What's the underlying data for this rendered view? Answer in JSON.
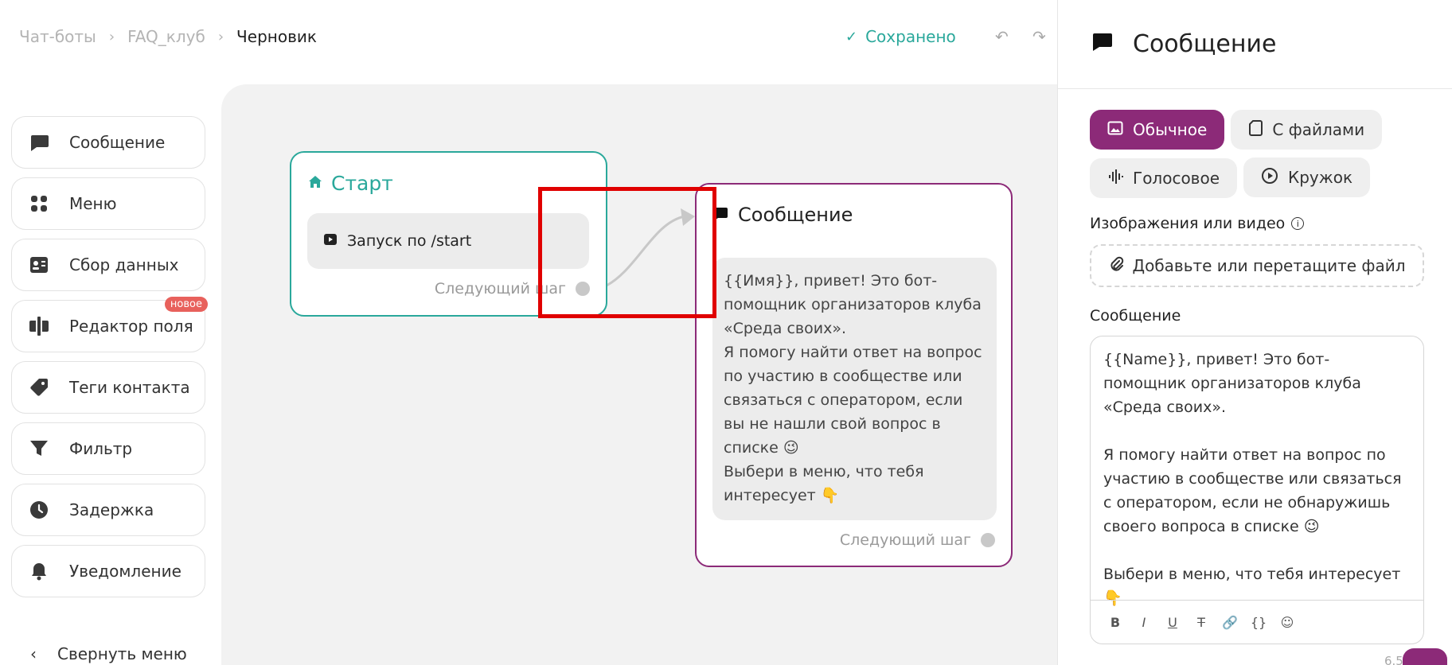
{
  "breadcrumb": {
    "items": [
      "Чат-боты",
      "FAQ_клуб"
    ],
    "current": "Черновик",
    "separator": "›"
  },
  "status": {
    "saved_label": "Сохранено"
  },
  "toolbar": {
    "undo_icon": "undo-icon",
    "redo_icon": "redo-icon"
  },
  "sidebar": {
    "items": [
      {
        "label": "Сообщение",
        "icon": "message-icon"
      },
      {
        "label": "Меню",
        "icon": "menu-grid-icon"
      },
      {
        "label": "Сбор данных",
        "icon": "contact-card-icon"
      },
      {
        "label": "Редактор поля",
        "icon": "field-editor-icon",
        "badge": "новое"
      },
      {
        "label": "Теги контакта",
        "icon": "tag-icon"
      },
      {
        "label": "Фильтр",
        "icon": "filter-icon"
      },
      {
        "label": "Задержка",
        "icon": "clock-icon"
      },
      {
        "label": "Уведомление",
        "icon": "bell-icon"
      }
    ],
    "collapse_label": "Свернуть меню"
  },
  "nodes": {
    "start": {
      "title": "Старт",
      "trigger": "Запуск по /start",
      "next_step": "Следующий шаг"
    },
    "message": {
      "title": "Сообщение",
      "text": "{{Имя}}, привет! Это бот-помощник организаторов клуба «Среда своих».\nЯ помогу найти ответ на вопрос по участию в сообществе или связаться с оператором, если вы не нашли свой вопрос в списке 😉\nВыбери в меню, что тебя интересует 👇",
      "next_step": "Следующий шаг"
    }
  },
  "panel": {
    "title": "Сообщение",
    "types": [
      {
        "label": "Обычное",
        "active": true
      },
      {
        "label": "С файлами",
        "active": false
      },
      {
        "label": "Голосовое",
        "active": false
      },
      {
        "label": "Кружок",
        "active": false
      }
    ],
    "media_label": "Изображения или видео",
    "dropzone_label": "Добавьте или перетащите файл",
    "message_label": "Сообщение",
    "message_text": "{{Name}}, привет! Это бот-помощник организаторов клуба «Среда своих».\n\nЯ помогу найти ответ на вопрос по участию в сообществе или связаться с оператором, если не обнаружишь своего вопроса в списке 😉\n\nВыбери в меню, что тебя интересует 👇",
    "format_tools": [
      "B",
      "I",
      "U",
      "S",
      "link",
      "{ }",
      "emoji"
    ],
    "counter": "6.5"
  },
  "colors": {
    "accent": "#8c2a78",
    "teal": "#2aa89b",
    "highlight": "#e00000"
  }
}
